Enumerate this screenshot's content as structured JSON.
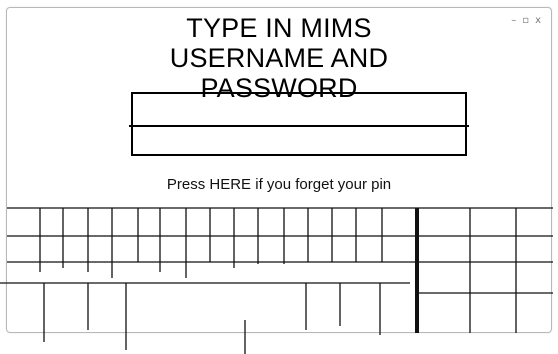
{
  "window": {
    "controls": {
      "minimize": "–",
      "maximize": "▫",
      "close": "x"
    }
  },
  "heading": {
    "line1": "TYPE IN MIMS",
    "line2": "USERNAME AND",
    "line3": "PASSWORD"
  },
  "login": {
    "username_value": "",
    "password_value": ""
  },
  "forgot": {
    "prefix": "Press ",
    "link": "HERE",
    "suffix": " if you forget your pin"
  }
}
